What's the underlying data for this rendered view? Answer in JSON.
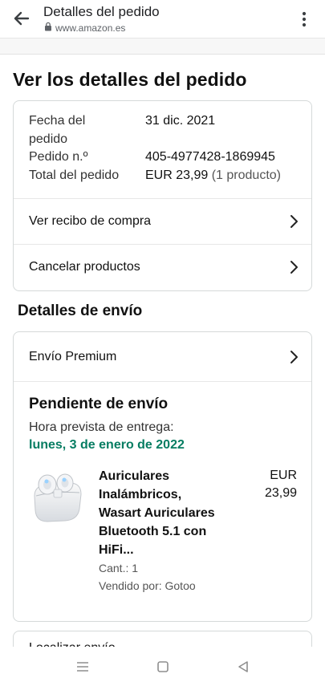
{
  "browser": {
    "title": "Detalles del pedido",
    "url": "www.amazon.es"
  },
  "order": {
    "heading": "Ver los detalles del pedido",
    "summary": {
      "date_label_line1": "Fecha del",
      "date_label_line2": "pedido",
      "date_value": "31 dic. 2021",
      "number_label": "Pedido n.º",
      "number_value": "405-4977428-1869945",
      "total_label": "Total del pedido",
      "total_value": "EUR 23,99",
      "total_count": "(1 producto)"
    },
    "actions": {
      "receipt": "Ver recibo de compra",
      "cancel": "Cancelar productos"
    }
  },
  "shipping": {
    "heading": "Detalles de envío",
    "method": "Envío Premium",
    "status": "Pendiente de envío",
    "eta_label": "Hora prevista de entrega:",
    "eta_date": "lunes, 3 de enero de 2022",
    "product": {
      "name_line1": "Auriculares",
      "name_line2": "Inalámbricos,",
      "name_line3": "Wasart Auriculares",
      "name_line4": "Bluetooth 5.1 con",
      "name_line5": "HiFi...",
      "currency": "EUR",
      "price": "23,99",
      "quantity": "Cant.: 1",
      "seller": "Vendido por: Gotoo"
    },
    "track": "Localizar envío"
  },
  "colors": {
    "eta": "#067d62",
    "border": "#d5d9d9"
  }
}
